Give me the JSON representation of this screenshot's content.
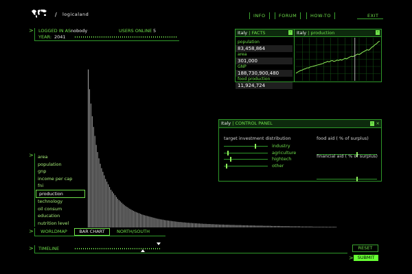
{
  "app": {
    "name": "logicaland",
    "logo_icon": "world-map-icon"
  },
  "topnav": {
    "info": "INFO",
    "forum": "FORUM",
    "howto": "HOW-TO",
    "exit": "EXIT"
  },
  "status": {
    "logged_in_label": "LOGGED IN AS:",
    "user": "nobody",
    "online_label": "USERS ONLINE",
    "online": "5",
    "year_label": "YEAR:",
    "year": "2041"
  },
  "facts": {
    "country": "Italy",
    "title": "FACTS",
    "rows": [
      {
        "label": "population",
        "value": "83,458,864"
      },
      {
        "label": "area",
        "value": "301,000"
      },
      {
        "label": "GNP",
        "value": "188,730,900,480"
      },
      {
        "label": "food production",
        "value": "11,924,724"
      }
    ]
  },
  "production": {
    "country": "Italy",
    "title": "production"
  },
  "control": {
    "country": "Italy",
    "title": "CONTROL PANEL",
    "investment_title": "target investment distribution",
    "investments": [
      {
        "label": "industry",
        "level": 0.72
      },
      {
        "label": "agriculture",
        "level": 0.08
      },
      {
        "label": "hightech",
        "level": 0.15
      },
      {
        "label": "other",
        "level": 0.05
      }
    ],
    "food_aid_title": "food aid ( % of surplus)",
    "food_aid_level": 0.68,
    "financial_aid_title": "financial aid  ( % of surplus)",
    "financial_aid_level": 0.68
  },
  "menu": {
    "items": [
      "area",
      "population",
      "gnp",
      "income per cap",
      "fni",
      "production",
      "technology",
      "oil consum",
      "education",
      "nutrition level"
    ],
    "selected": "production"
  },
  "view_tabs": {
    "worldmap": "WORLDMAP",
    "barchart": "BAR CHART",
    "northsouth": "NORTH/SOUTH",
    "active": "BAR CHART"
  },
  "timeline": {
    "label": "TIMELINE"
  },
  "buttons": {
    "reset": "RESET",
    "submit": "SUBMIT"
  },
  "colors": {
    "accent": "#6fe04a",
    "border": "#2f9a2a",
    "submit_bg": "#66ff33"
  },
  "chart_data": {
    "type": "bar",
    "values": [
      0.88,
      0.77,
      0.69,
      0.62,
      0.56,
      0.51,
      0.46,
      0.42,
      0.385,
      0.355,
      0.33,
      0.31,
      0.29,
      0.27,
      0.255,
      0.24,
      0.225,
      0.21,
      0.2,
      0.19,
      0.18,
      0.17,
      0.16,
      0.152,
      0.145,
      0.138,
      0.131,
      0.125,
      0.119,
      0.114,
      0.109,
      0.104,
      0.1,
      0.096,
      0.092,
      0.088,
      0.085,
      0.082,
      0.079,
      0.076,
      0.073,
      0.07,
      0.068,
      0.066,
      0.064,
      0.062,
      0.06,
      0.058,
      0.056,
      0.054,
      0.052,
      0.05,
      0.048,
      0.047,
      0.045,
      0.044,
      0.043,
      0.041,
      0.04,
      0.039,
      0.038,
      0.037,
      0.036,
      0.035,
      0.034,
      0.033,
      0.032,
      0.031,
      0.03,
      0.03,
      0.029,
      0.028,
      0.028,
      0.027,
      0.026,
      0.026,
      0.025,
      0.025,
      0.024,
      0.024,
      0.023,
      0.023,
      0.022,
      0.022,
      0.021,
      0.021,
      0.02,
      0.02,
      0.02,
      0.019,
      0.019,
      0.019,
      0.018,
      0.018,
      0.018,
      0.017,
      0.017,
      0.017,
      0.016,
      0.016,
      0.016,
      0.016,
      0.015,
      0.015,
      0.015,
      0.015,
      0.014,
      0.014,
      0.014,
      0.014,
      0.013,
      0.013,
      0.013,
      0.013,
      0.013,
      0.012,
      0.012,
      0.012,
      0.012,
      0.012,
      0.011,
      0.011,
      0.011,
      0.011,
      0.011,
      0.01,
      0.01,
      0.01,
      0.01,
      0.01,
      0.01,
      0.009,
      0.009,
      0.009,
      0.009,
      0.009,
      0.009,
      0.008,
      0.008,
      0.008,
      0.008,
      0.008,
      0.008,
      0.008,
      0.007,
      0.007,
      0.007,
      0.007,
      0.007,
      0.007,
      0.007,
      0.006,
      0.006,
      0.006,
      0.006,
      0.006,
      0.006,
      0.006,
      0.006,
      0.005,
      0.005,
      0.005,
      0.005,
      0.005,
      0.005,
      0.005,
      0.005,
      0.005,
      0.004,
      0.004,
      0.004,
      0.004,
      0.004,
      0.004,
      0.004,
      0.004,
      0.004,
      0.004,
      0.003,
      0.003,
      0.003,
      0.003,
      0.003,
      0.003,
      0.003,
      0.003,
      0.003
    ],
    "production_series": [
      0.18,
      0.2,
      0.22,
      0.24,
      0.25,
      0.27,
      0.28,
      0.3,
      0.3,
      0.32,
      0.33,
      0.34,
      0.35,
      0.36,
      0.37,
      0.38,
      0.39,
      0.4,
      0.42,
      0.43,
      0.45,
      0.44,
      0.46,
      0.47,
      0.45,
      0.46,
      0.48,
      0.47,
      0.49,
      0.48,
      0.5,
      0.52,
      0.51,
      0.53,
      0.55,
      0.57,
      0.56,
      0.58,
      0.6,
      0.62,
      0.61,
      0.63,
      0.66,
      0.68,
      0.7,
      0.72,
      0.71,
      0.74,
      0.78,
      0.8,
      0.84,
      0.86,
      0.9,
      0.92
    ],
    "production_marker": 0.7
  }
}
